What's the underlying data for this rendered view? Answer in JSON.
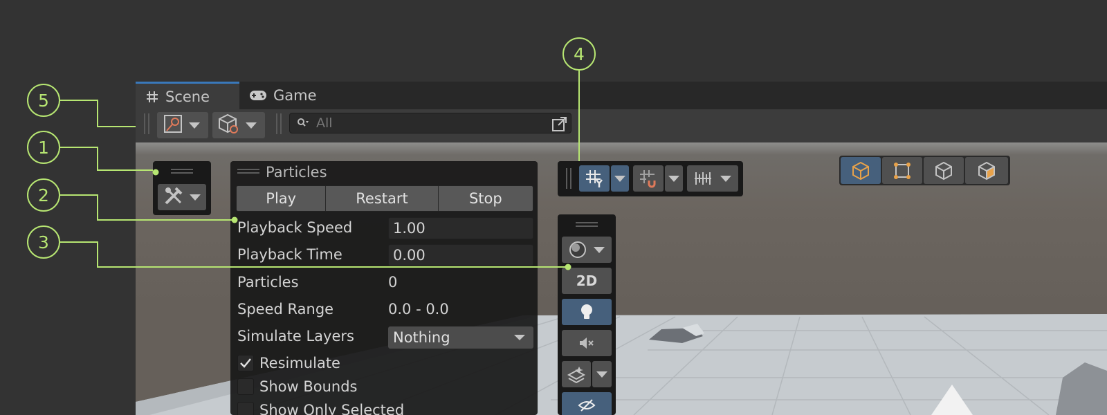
{
  "tabs": [
    {
      "label": "Scene",
      "icon": "hash-icon",
      "active": true
    },
    {
      "label": "Game",
      "icon": "gamepad-icon",
      "active": false
    }
  ],
  "toolbar": {
    "search_placeholder": "All"
  },
  "particles_overlay": {
    "title": "Particles",
    "buttons": [
      "Play",
      "Restart",
      "Stop"
    ],
    "playback_speed_label": "Playback Speed",
    "playback_speed_value": "1.00",
    "playback_time_label": "Playback Time",
    "playback_time_value": "0.00",
    "particles_label": "Particles",
    "particles_value": "0",
    "speed_range_label": "Speed Range",
    "speed_range_value": "0.0 - 0.0",
    "simulate_layers_label": "Simulate Layers",
    "simulate_layers_value": "Nothing",
    "resimulate_label": "Resimulate",
    "resimulate_checked": true,
    "show_bounds_label": "Show Bounds",
    "show_bounds_checked": false,
    "show_only_selected_label": "Show Only Selected"
  },
  "view_options": {
    "button_2d": "2D"
  },
  "callouts": [
    "1",
    "2",
    "3",
    "4",
    "5"
  ],
  "colors": {
    "callout": "#b7e672",
    "accent_blue": "#3a79bb",
    "active_button": "#46607c",
    "orange": "#e8a24a"
  }
}
